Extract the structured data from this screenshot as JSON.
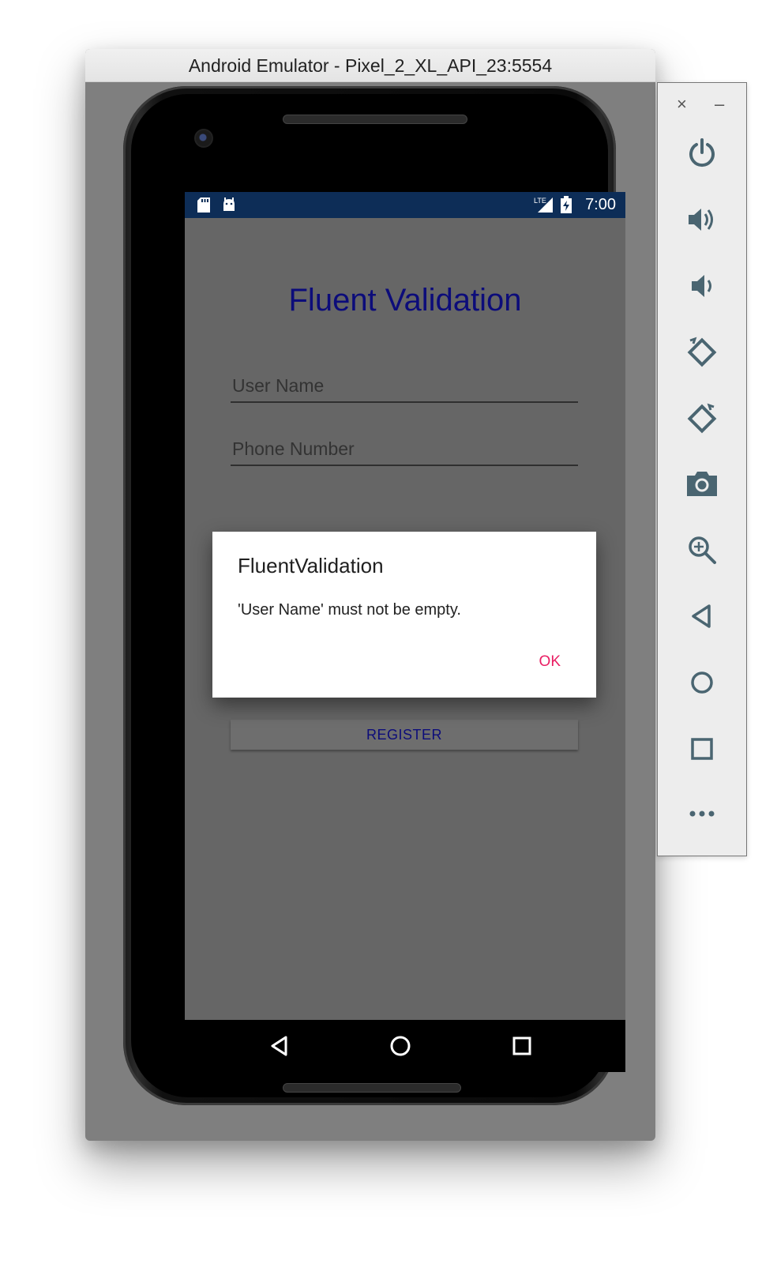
{
  "window": {
    "title": "Android Emulator - Pixel_2_XL_API_23:5554"
  },
  "statusbar": {
    "time": "7:00",
    "icons": [
      "sd-card-icon",
      "android-debug-icon",
      "lte-signal-icon",
      "battery-charging-icon"
    ]
  },
  "app": {
    "title": "Fluent Validation",
    "fields": [
      {
        "placeholder": "User Name"
      },
      {
        "placeholder": "Phone Number"
      }
    ],
    "register_label": "REGISTER"
  },
  "dialog": {
    "title": "FluentValidation",
    "message": "'User Name' must not be empty.",
    "ok_label": "OK"
  },
  "toolbar": {
    "close_label": "×",
    "minimize_label": "–",
    "buttons": [
      "power-icon",
      "volume-up-icon",
      "volume-down-icon",
      "rotate-left-icon",
      "rotate-right-icon",
      "camera-icon",
      "zoom-icon",
      "back-icon",
      "home-icon",
      "overview-icon",
      "more-icon"
    ]
  },
  "colors": {
    "statusbar": "#0d2d57",
    "accent": "#e91e63",
    "title": "#0c0c7a",
    "screen": "#666666"
  }
}
